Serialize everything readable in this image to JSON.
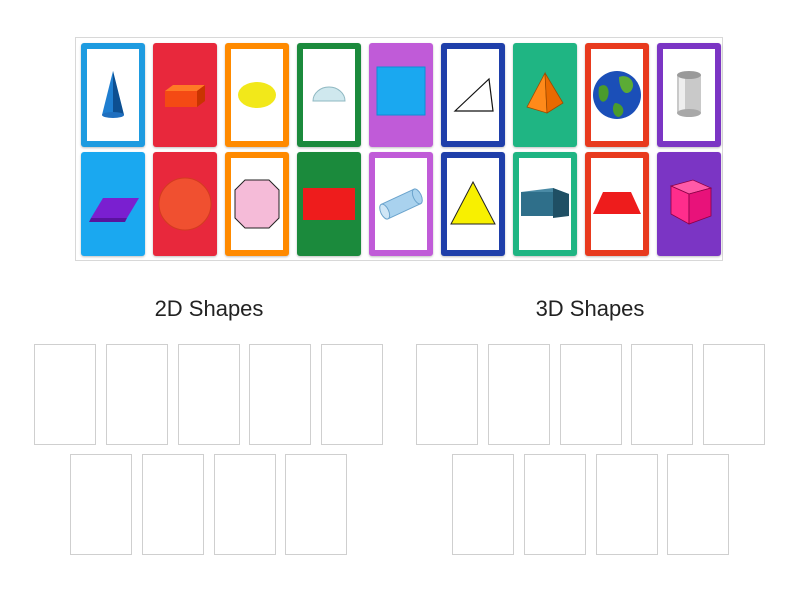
{
  "groups": {
    "left_label": "2D Shapes",
    "right_label": "3D Shapes"
  },
  "cards_top": [
    {
      "name": "cone-card",
      "color": "#1e9be0",
      "style": "framed",
      "shape": "cone"
    },
    {
      "name": "rectangular-prism-card",
      "color": "#e8283c",
      "style": "solid",
      "shape": "red-prism"
    },
    {
      "name": "oval-card",
      "color": "#ff8a00",
      "style": "framed",
      "shape": "oval"
    },
    {
      "name": "semicircle-card",
      "color": "#1b8a3c",
      "style": "framed",
      "shape": "semicircle"
    },
    {
      "name": "square-card",
      "color": "#c05bd8",
      "style": "solid",
      "shape": "square"
    },
    {
      "name": "scalene-triangle-card",
      "color": "#1f3faa",
      "style": "framed",
      "shape": "scalene-triangle"
    },
    {
      "name": "pyramid-card",
      "color": "#1fb583",
      "style": "solid",
      "shape": "pyramid"
    },
    {
      "name": "sphere-card",
      "color": "#e83a1e",
      "style": "framed",
      "shape": "sphere"
    },
    {
      "name": "cylinder-can-card",
      "color": "#7b35c4",
      "style": "framed",
      "shape": "can"
    }
  ],
  "cards_bottom": [
    {
      "name": "parallelogram-card",
      "color": "#1aa8f0",
      "style": "solid",
      "shape": "parallelogram"
    },
    {
      "name": "circle-card",
      "color": "#e8283c",
      "style": "solid",
      "shape": "circle"
    },
    {
      "name": "octagon-card",
      "color": "#ff8a00",
      "style": "framed",
      "shape": "octagon"
    },
    {
      "name": "rectangle-card",
      "color": "#1b8a3c",
      "style": "solid",
      "shape": "rectangle"
    },
    {
      "name": "cylinder-card",
      "color": "#c05bd8",
      "style": "framed",
      "shape": "cylinder"
    },
    {
      "name": "triangle-card",
      "color": "#1f3faa",
      "style": "framed",
      "shape": "triangle"
    },
    {
      "name": "cuboid-card",
      "color": "#1fb583",
      "style": "framed",
      "shape": "cuboid"
    },
    {
      "name": "trapezoid-card",
      "color": "#e83a1e",
      "style": "framed",
      "shape": "trapezoid"
    },
    {
      "name": "cube-card",
      "color": "#7b35c4",
      "style": "solid",
      "shape": "cube"
    }
  ],
  "drop_slots": {
    "left_rows": [
      5,
      4
    ],
    "right_rows": [
      5,
      4
    ]
  }
}
